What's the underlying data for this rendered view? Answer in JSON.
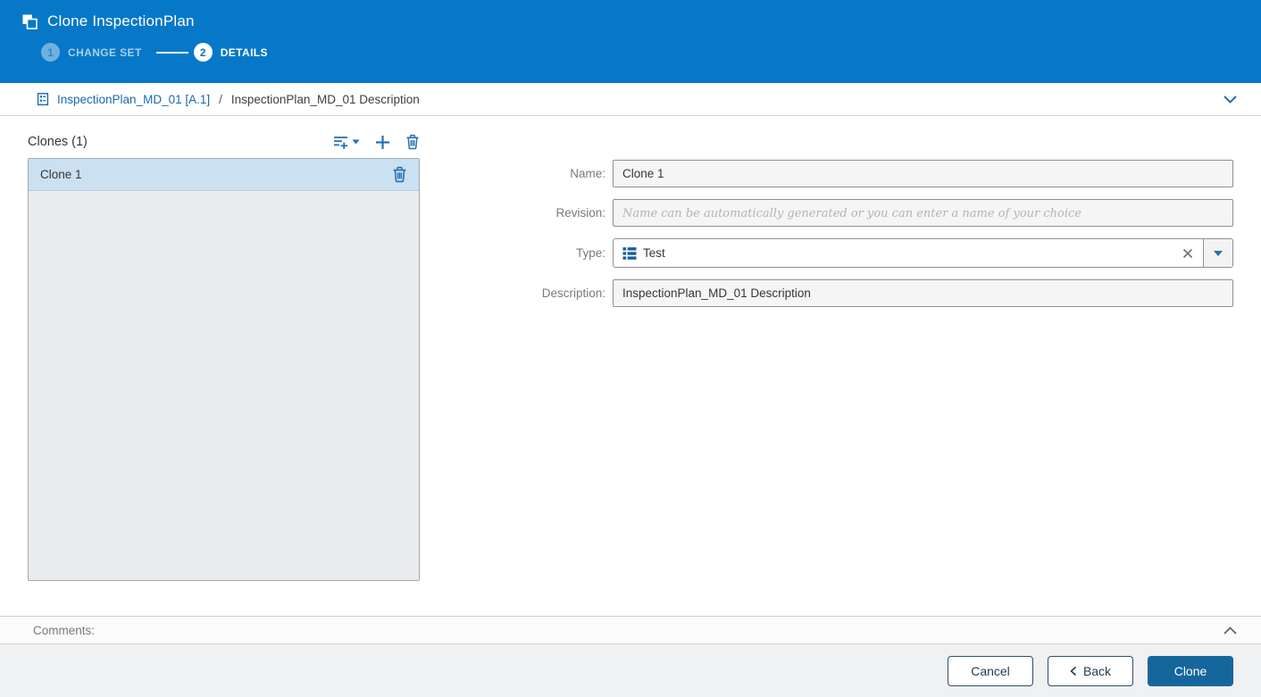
{
  "header": {
    "title": "Clone InspectionPlan",
    "steps": [
      {
        "number": "1",
        "label": "CHANGE SET",
        "state": "done"
      },
      {
        "number": "2",
        "label": "DETAILS",
        "state": "active"
      }
    ]
  },
  "breadcrumb": {
    "object_link": "InspectionPlan_MD_01 [A.1]",
    "separator": "/",
    "current": "InspectionPlan_MD_01 Description"
  },
  "clones_panel": {
    "title": "Clones (1)",
    "items": [
      {
        "name": "Clone 1",
        "selected": true
      }
    ]
  },
  "form": {
    "name": {
      "label": "Name:",
      "value": "Clone 1"
    },
    "revision": {
      "label": "Revision:",
      "value": "",
      "placeholder": "Name can be automatically generated or you can enter a name of your choice"
    },
    "type": {
      "label": "Type:",
      "value": "Test"
    },
    "description": {
      "label": "Description:",
      "value": "InspectionPlan_MD_01 Description"
    }
  },
  "comments": {
    "label": "Comments:"
  },
  "footer": {
    "cancel_label": "Cancel",
    "back_label": "Back",
    "clone_label": "Clone"
  },
  "icons": {
    "title": "clone-icon",
    "breadcrumb_object": "inspection-plan-icon",
    "breadcrumb_expand": "chevron-down-icon",
    "panel_toolbar": [
      "add-list-icon",
      "caret-down-icon",
      "plus-icon",
      "trash-icon"
    ],
    "row_delete": "trash-icon",
    "type_value": "type-object-icon",
    "type_clear": "close-icon",
    "type_dropdown": "caret-down-icon",
    "comments_collapse": "chevron-up-icon",
    "back": "chevron-left-icon"
  },
  "colors": {
    "header_bg": "#0778c8",
    "accent_icon_blue": "#2470b3",
    "link_blue": "#1a6aae",
    "selected_row_bg": "#cbe0f1",
    "primary_button_bg": "#16669e",
    "input_bg": "#f5f5f5",
    "footer_bg": "#f0f1f2"
  }
}
